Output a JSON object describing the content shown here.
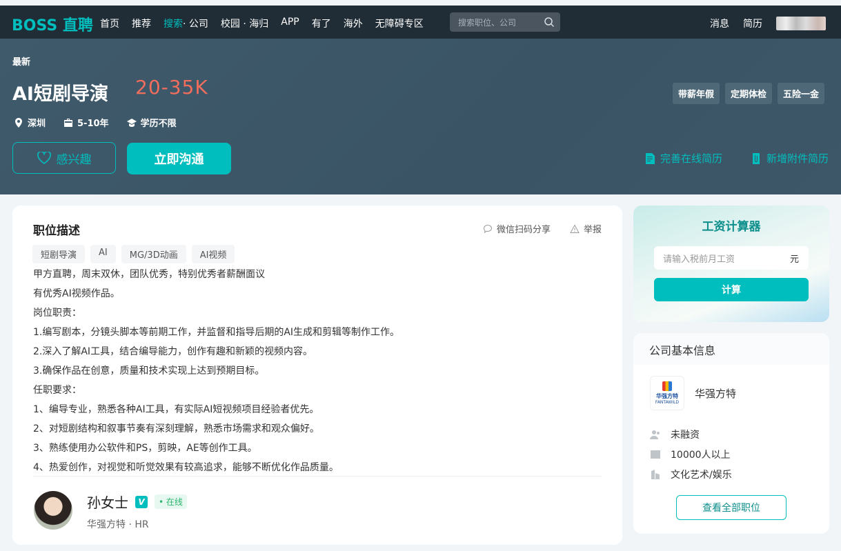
{
  "header": {
    "logo": "BOSS 直聘",
    "nav": [
      {
        "label": "首页"
      },
      {
        "label": "推荐"
      },
      {
        "label": "搜索",
        "sub": "· 公司"
      },
      {
        "label": "校园 · 海归"
      },
      {
        "label": "APP"
      },
      {
        "label": "有了"
      },
      {
        "label": "海外"
      },
      {
        "label": "无障碍专区"
      }
    ],
    "search_placeholder": "搜索职位、公司",
    "messages": "消息",
    "resume": "简历"
  },
  "job": {
    "badge": "最新",
    "title": "AI短剧导演",
    "salary": "20-35K",
    "location": "深圳",
    "experience": "5-10年",
    "education": "学历不限",
    "welfare": [
      "带薪年假",
      "定期体检",
      "五险一金"
    ],
    "interest_label": "感兴趣",
    "chat_label": "立即沟通",
    "complete_resume": "完善在线简历",
    "add_attachment": "新增附件简历"
  },
  "description": {
    "title": "职位描述",
    "share": "微信扫码分享",
    "report": "举报",
    "tags": [
      "短剧导演",
      "AI",
      "MG/3D动画",
      "AI视频"
    ],
    "lines": [
      "甲方直聘，周末双休，团队优秀，特别优秀者薪酬面议",
      "有优秀AI视频作品。",
      "岗位职责：",
      "1.编写剧本，分镜头脚本等前期工作，并监督和指导后期的AI生成和剪辑等制作工作。",
      "2.深入了解AI工具，结合编导能力，创作有趣和新颖的视频内容。",
      "3.确保作品在创意，质量和技术实现上达到预期目标。",
      "任职要求：",
      "1、编导专业，熟悉各种AI工具，有实际AI短视频项目经验者优先。",
      "2、对短剧结构和叙事节奏有深刻理解，熟悉市场需求和观众偏好。",
      "3、熟练使用办公软件和PS，剪映，AE等创作工具。",
      "4、热爱创作，对视觉和听觉效果有较高追求，能够不断优化作品质量。"
    ]
  },
  "hr": {
    "name": "孙女士",
    "verified": "V",
    "status": "• 在线",
    "company": "华强方特",
    "role": "HR"
  },
  "calculator": {
    "title": "工资计算器",
    "placeholder": "请输入税前月工资",
    "unit": "元",
    "button": "计算"
  },
  "company": {
    "header": "公司基本信息",
    "logo_cn": "华强方特",
    "logo_en": "FANTAWILD",
    "name": "华强方特",
    "funding": "未融资",
    "size": "10000人以上",
    "industry": "文化艺术/娱乐",
    "all_jobs": "查看全部职位"
  }
}
